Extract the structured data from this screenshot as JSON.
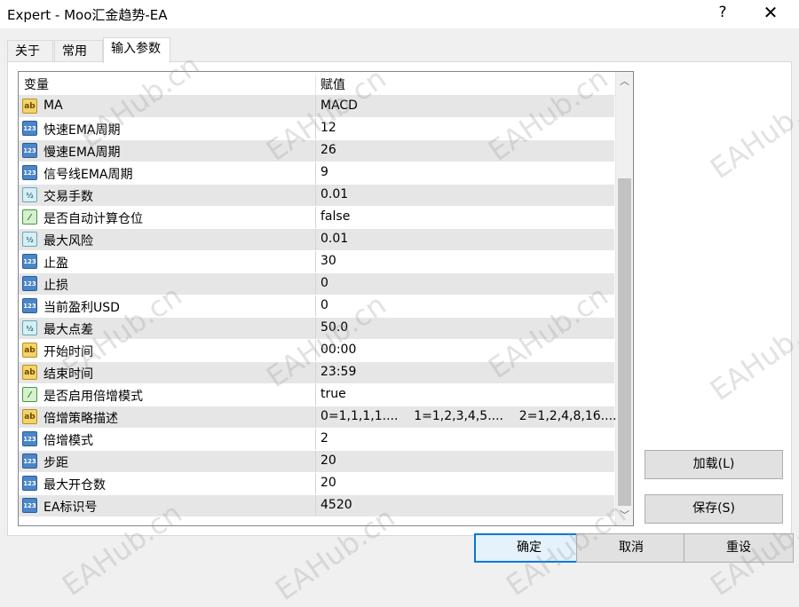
{
  "window": {
    "title": "Expert - Moo汇金趋势-EA",
    "help_glyph": "?",
    "close_glyph": "✕"
  },
  "tabs": [
    "关于",
    "常用",
    "输入参数"
  ],
  "grid": {
    "headers": {
      "name": "变量",
      "value": "赋值"
    },
    "rows": [
      {
        "type": "ab",
        "icon_text": "ab",
        "name": "MA",
        "value": "MACD"
      },
      {
        "type": "num",
        "icon_text": "123",
        "name": "快速EMA周期",
        "value": "12"
      },
      {
        "type": "num",
        "icon_text": "123",
        "name": "慢速EMA周期",
        "value": "26"
      },
      {
        "type": "num",
        "icon_text": "123",
        "name": "信号线EMA周期",
        "value": "9"
      },
      {
        "type": "frac",
        "icon_text": "½",
        "name": "交易手数",
        "value": "0.01"
      },
      {
        "type": "bool",
        "icon_text": "⁄",
        "name": "是否自动计算仓位",
        "value": "false"
      },
      {
        "type": "frac",
        "icon_text": "½",
        "name": "最大风险",
        "value": "0.01"
      },
      {
        "type": "num",
        "icon_text": "123",
        "name": "止盈",
        "value": "30"
      },
      {
        "type": "num",
        "icon_text": "123",
        "name": "止损",
        "value": "0"
      },
      {
        "type": "num",
        "icon_text": "123",
        "name": "当前盈利USD",
        "value": "0"
      },
      {
        "type": "frac",
        "icon_text": "½",
        "name": "最大点差",
        "value": "50.0"
      },
      {
        "type": "ab",
        "icon_text": "ab",
        "name": "开始时间",
        "value": "00:00"
      },
      {
        "type": "ab",
        "icon_text": "ab",
        "name": "结束时间",
        "value": "23:59"
      },
      {
        "type": "bool",
        "icon_text": "⁄",
        "name": "是否启用倍增模式",
        "value": "true"
      },
      {
        "type": "ab",
        "icon_text": "ab",
        "name": "倍增策略描述",
        "value": "0=1,1,1,1....    1=1,2,3,4,5....    2=1,2,4,8,16....."
      },
      {
        "type": "num",
        "icon_text": "123",
        "name": "倍增模式",
        "value": "2"
      },
      {
        "type": "num",
        "icon_text": "123",
        "name": "步距",
        "value": "20"
      },
      {
        "type": "num",
        "icon_text": "123",
        "name": "最大开仓数",
        "value": "20"
      },
      {
        "type": "num",
        "icon_text": "123",
        "name": "EA标识号",
        "value": "4520"
      }
    ],
    "scroll_up": "︿",
    "scroll_down": "﹀"
  },
  "buttons": {
    "load": "加载(L)",
    "save": "保存(S)",
    "ok": "确定",
    "cancel": "取消",
    "reset": "重设"
  },
  "watermark": "EAHub.cn"
}
